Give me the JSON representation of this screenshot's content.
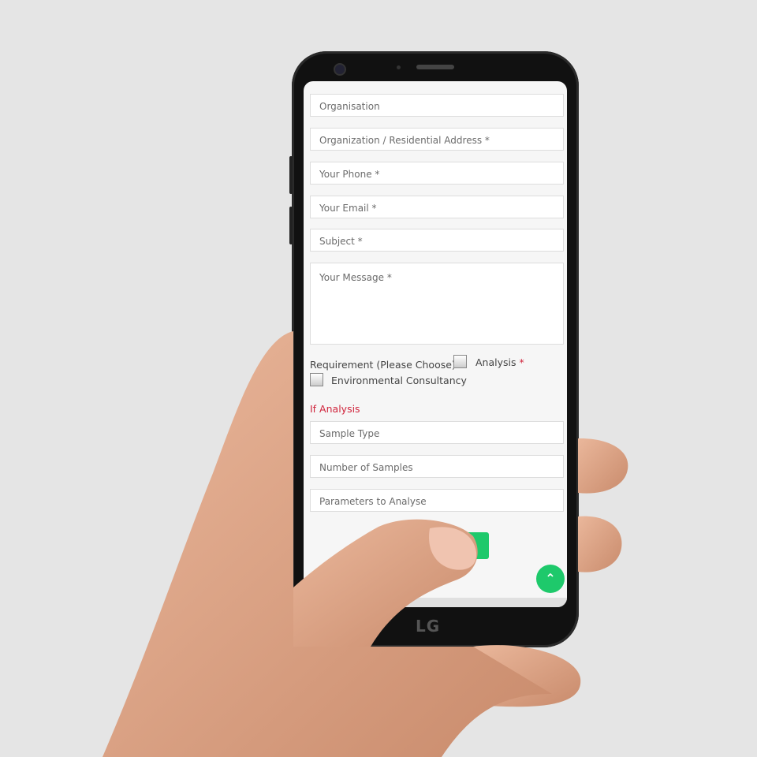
{
  "device": {
    "brand": "LG"
  },
  "form": {
    "fields": [
      {
        "placeholder": "Organisation"
      },
      {
        "placeholder": "Organization / Residential Address *"
      },
      {
        "placeholder": "Your Phone *"
      },
      {
        "placeholder": "Your Email *"
      },
      {
        "placeholder": "Subject *"
      }
    ],
    "message_placeholder": "Your Message *",
    "requirement_label": "Requirement (Please Choose)",
    "options": [
      {
        "label": "Analysis",
        "checked": false
      },
      {
        "label": "Environmental Consultancy",
        "checked": false
      }
    ],
    "required_mark": "*",
    "if_analysis_heading": "If Analysis",
    "analysis_fields": [
      {
        "placeholder": "Sample Type"
      },
      {
        "placeholder": "Number of Samples"
      },
      {
        "placeholder": "Parameters to Analyse"
      }
    ]
  },
  "scroll_top_icon": "chevron-up-icon",
  "colors": {
    "accent": "#1ec96b",
    "required": "#d0243c"
  }
}
